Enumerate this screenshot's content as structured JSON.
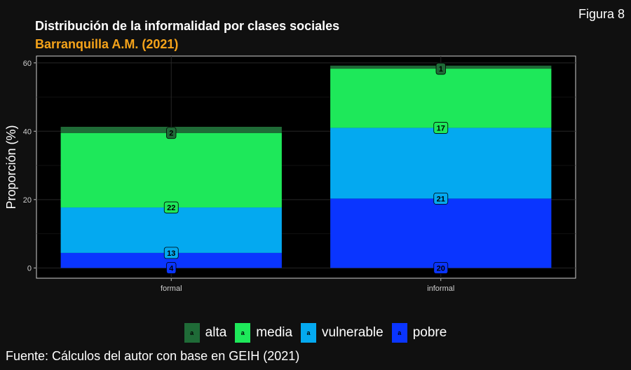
{
  "figure_label": "Figura 8",
  "source_text": "Fuente: Cálculos del autor con base en GEIH (2021)",
  "legend_key_glyph": "a",
  "colors": {
    "alta": "#1f6b37",
    "media": "#1ee85a",
    "vulnerable": "#04a9f0",
    "pobre": "#0a35ff",
    "panel_bg": "#000000",
    "page_bg": "#101010",
    "subtitle": "#f5a31a"
  },
  "chart_data": {
    "type": "bar",
    "stacked": true,
    "title": "Distribución de la informalidad por clases sociales",
    "subtitle": "Barranquilla A.M. (2021)",
    "xlabel": "",
    "ylabel": "Proporción (%)",
    "ylim": [
      -3,
      62
    ],
    "yticks": [
      0,
      20,
      40,
      60
    ],
    "grid": true,
    "legend_position": "bottom",
    "categories": [
      "formal",
      "informal"
    ],
    "series": [
      {
        "name": "pobre",
        "values": [
          4.4,
          20.3
        ]
      },
      {
        "name": "vulnerable",
        "values": [
          13.3,
          20.7
        ]
      },
      {
        "name": "media",
        "values": [
          21.8,
          17.3
        ]
      },
      {
        "name": "alta",
        "values": [
          1.8,
          0.9
        ]
      }
    ],
    "data_labels": [
      [
        "4",
        "20"
      ],
      [
        "13",
        "21"
      ],
      [
        "22",
        "17"
      ],
      [
        "2",
        "1"
      ]
    ],
    "label_positions": [
      [
        0,
        0
      ],
      [
        4.4,
        20.3
      ],
      [
        17.7,
        41.0
      ],
      [
        39.5,
        58.3
      ]
    ]
  }
}
